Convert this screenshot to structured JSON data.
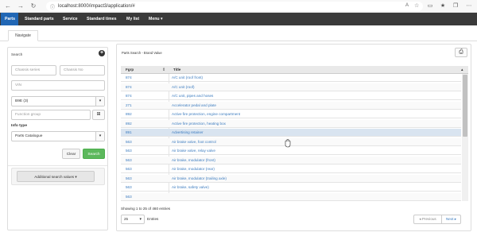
{
  "browser": {
    "url": "localhost:8000/impact3/application/#"
  },
  "menu": [
    {
      "label": "Parts"
    },
    {
      "label": "Standard parts"
    },
    {
      "label": "Service"
    },
    {
      "label": "Standard times"
    },
    {
      "label": "My list"
    },
    {
      "label": "Menu ▾"
    }
  ],
  "tab": {
    "label": "Navigate"
  },
  "search": {
    "title": "Search",
    "chassis_series_placeholder": "Chassis series",
    "chassis_no_placeholder": "Chassis No",
    "vin_placeholder": "VIN",
    "brand_value": "B9E (3)",
    "function_group_placeholder": "Function group",
    "info_type_label": "Info type",
    "info_type_value": "Parts Catalogue",
    "clear_label": "Clear",
    "search_label": "Search",
    "additional_label": "Additional search values"
  },
  "results": {
    "breadcrumb": "Parts Search - Brand Value",
    "col_fgrp": "Fgrp",
    "col_title": "Title",
    "rows": [
      {
        "fgrp": "874",
        "title": "A/C unit (roof front)"
      },
      {
        "fgrp": "874",
        "title": "A/C unit (roof)"
      },
      {
        "fgrp": "874",
        "title": "A/C unit, pipes and hoses"
      },
      {
        "fgrp": "271",
        "title": "Accelerator pedal and plate"
      },
      {
        "fgrp": "892",
        "title": "Active fire protection, engine compartment"
      },
      {
        "fgrp": "892",
        "title": "Active fire protection, heating box"
      },
      {
        "fgrp": "891",
        "title": "Advertising retainer"
      },
      {
        "fgrp": "563",
        "title": "Air brake valve, foot control"
      },
      {
        "fgrp": "563",
        "title": "Air brake valve, relay valve"
      },
      {
        "fgrp": "563",
        "title": "Air brake, modulator (front)"
      },
      {
        "fgrp": "563",
        "title": "Air brake, modulator (rear)"
      },
      {
        "fgrp": "563",
        "title": "Air brake, modulator (trailing axle)"
      },
      {
        "fgrp": "563",
        "title": "Air brake, safety valve)"
      },
      {
        "fgrp": "563",
        "title": ""
      }
    ],
    "showing": "Showing 1 to 25 of 460 entries",
    "page_size": "25",
    "entries_label": "Entries",
    "previous_label": "◂ Previous",
    "next_label": "Next ▸"
  }
}
